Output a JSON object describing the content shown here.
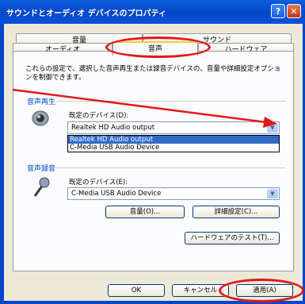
{
  "window": {
    "title": "サウンドとオーディオ デバイスのプロパティ",
    "help_glyph": "?",
    "close_glyph": "✕"
  },
  "tabs": {
    "row1": [
      "音量",
      "サウンド"
    ],
    "row2": [
      "オーディオ",
      "音声",
      "ハードウェア"
    ],
    "active": "音声"
  },
  "description": "これらの設定で、選択した音声再生または録音デバイスの、音量や詳細設定オプションを制御できます。",
  "playback": {
    "group_label": "音声再生",
    "default_label": "既定のデバイス(D):",
    "selected": "Realtek HD Audio output",
    "options": [
      "Realtek HD Audio output",
      "C-Media USB Audio Device"
    ],
    "icon": "speaker-icon"
  },
  "recording": {
    "group_label": "音声録音",
    "default_label": "既定のデバイス(E):",
    "selected": "C-Media USB Audio Device",
    "icon": "microphone-icon",
    "volume_button": "音量(O)...",
    "advanced_button": "詳細設定(C)..."
  },
  "hardware_test_button": "ハードウェアのテスト(T)...",
  "footer": {
    "ok": "OK",
    "cancel": "キャンセル",
    "apply": "適用(A)"
  },
  "annotation_color": "#e3171b"
}
